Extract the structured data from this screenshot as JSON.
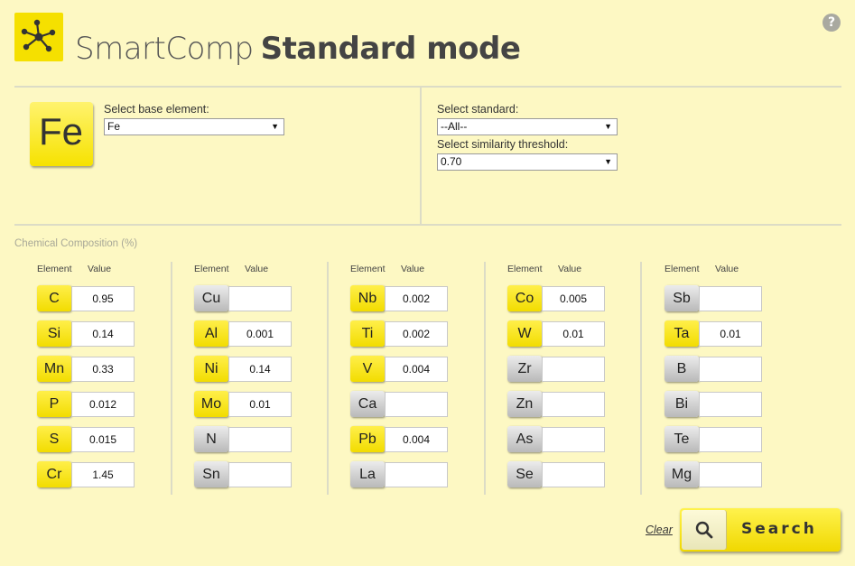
{
  "header": {
    "brand": "SmartComp",
    "mode": "Standard mode",
    "help": "?"
  },
  "base": {
    "tile_symbol": "Fe",
    "label": "Select base element:",
    "value": "Fe"
  },
  "standard": {
    "label": "Select standard:",
    "value": "--All--"
  },
  "threshold": {
    "label": "Select similarity threshold:",
    "value": "0.70"
  },
  "composition": {
    "title": "Chemical Composition (%)",
    "col_element": "Element",
    "col_value": "Value",
    "columns": [
      [
        {
          "el": "C",
          "value": "0.95",
          "active": true
        },
        {
          "el": "Si",
          "value": "0.14",
          "active": true
        },
        {
          "el": "Mn",
          "value": "0.33",
          "active": true
        },
        {
          "el": "P",
          "value": "0.012",
          "active": true
        },
        {
          "el": "S",
          "value": "0.015",
          "active": true
        },
        {
          "el": "Cr",
          "value": "1.45",
          "active": true
        }
      ],
      [
        {
          "el": "Cu",
          "value": "",
          "active": false
        },
        {
          "el": "Al",
          "value": "0.001",
          "active": true
        },
        {
          "el": "Ni",
          "value": "0.14",
          "active": true
        },
        {
          "el": "Mo",
          "value": "0.01",
          "active": true
        },
        {
          "el": "N",
          "value": "",
          "active": false
        },
        {
          "el": "Sn",
          "value": "",
          "active": false
        }
      ],
      [
        {
          "el": "Nb",
          "value": "0.002",
          "active": true
        },
        {
          "el": "Ti",
          "value": "0.002",
          "active": true
        },
        {
          "el": "V",
          "value": "0.004",
          "active": true
        },
        {
          "el": "Ca",
          "value": "",
          "active": false
        },
        {
          "el": "Pb",
          "value": "0.004",
          "active": true
        },
        {
          "el": "La",
          "value": "",
          "active": false
        }
      ],
      [
        {
          "el": "Co",
          "value": "0.005",
          "active": true
        },
        {
          "el": "W",
          "value": "0.01",
          "active": true
        },
        {
          "el": "Zr",
          "value": "",
          "active": false
        },
        {
          "el": "Zn",
          "value": "",
          "active": false
        },
        {
          "el": "As",
          "value": "",
          "active": false
        },
        {
          "el": "Se",
          "value": "",
          "active": false
        }
      ],
      [
        {
          "el": "Sb",
          "value": "",
          "active": false
        },
        {
          "el": "Ta",
          "value": "0.01",
          "active": true
        },
        {
          "el": "B",
          "value": "",
          "active": false
        },
        {
          "el": "Bi",
          "value": "",
          "active": false
        },
        {
          "el": "Te",
          "value": "",
          "active": false
        },
        {
          "el": "Mg",
          "value": "",
          "active": false
        }
      ]
    ]
  },
  "actions": {
    "clear": "Clear",
    "search": "Search"
  },
  "icons": {
    "logo": "molecule-icon",
    "help": "help-icon",
    "search": "magnifier-icon"
  },
  "colors": {
    "background": "#fdf8c3",
    "accent": "#f5e000",
    "inactive": "#c4c4c4"
  }
}
